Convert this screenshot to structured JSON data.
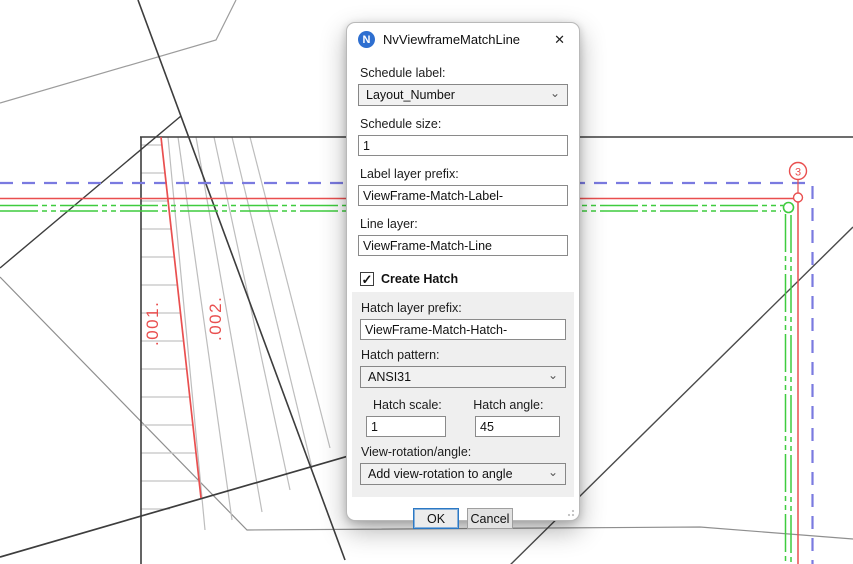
{
  "window": {
    "title": "NvViewframeMatchLine",
    "icon_letter": "N",
    "close_glyph": "✕"
  },
  "form": {
    "schedule_label": {
      "label": "Schedule label:",
      "value": "Layout_Number"
    },
    "schedule_size": {
      "label": "Schedule size:",
      "value": "1"
    },
    "label_layer_prefix": {
      "label": "Label layer prefix:",
      "value": "ViewFrame-Match-Label-"
    },
    "line_layer": {
      "label": "Line layer:",
      "value": "ViewFrame-Match-Line"
    },
    "create_hatch": {
      "label": "Create Hatch",
      "check_glyph": "✓"
    },
    "hatch_layer_prefix": {
      "label": "Hatch layer prefix:",
      "value": "ViewFrame-Match-Hatch-"
    },
    "hatch_pattern": {
      "label": "Hatch pattern:",
      "value": "ANSI31"
    },
    "hatch_scale": {
      "label": "Hatch scale:",
      "value": "1"
    },
    "hatch_angle": {
      "label": "Hatch angle:",
      "value": "45"
    },
    "view_rotation": {
      "label": "View-rotation/angle:",
      "value": "Add view-rotation to angle"
    },
    "chevron_glyph": "⌄"
  },
  "buttons": {
    "ok": "OK",
    "cancel": "Cancel"
  },
  "drawing": {
    "matchline_label_1": ".001.",
    "matchline_label_2": ".002.",
    "schedule_bubble": "3",
    "colors": {
      "matchline_red": "#e94f4f",
      "viewframe_green": "#3ecc3e",
      "boundary_blue": "#7a7ae0",
      "accent_blue": "#2b78c4"
    }
  }
}
